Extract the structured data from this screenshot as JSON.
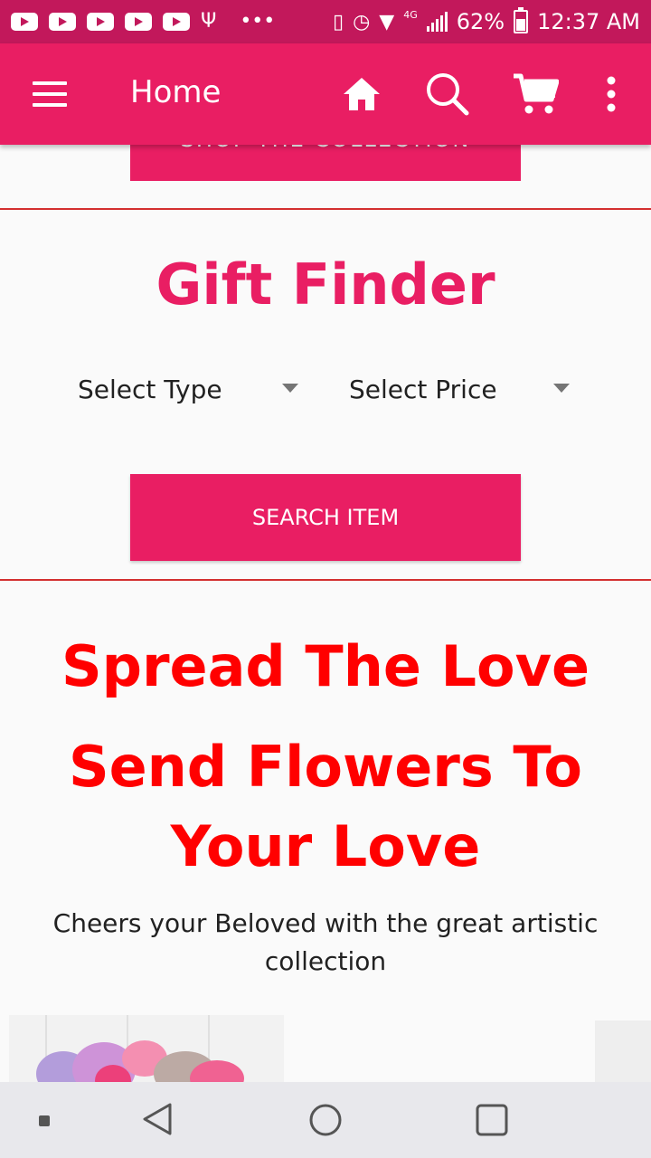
{
  "status_bar": {
    "more": "•••",
    "net_label": "4G",
    "battery": "62%",
    "time": "12:37 AM"
  },
  "app_bar": {
    "title": "Home"
  },
  "hero": {
    "shop_button": "SHOP THE COLLECTION"
  },
  "gift_finder": {
    "title": "Gift Finder",
    "type_select": "Select Type",
    "price_select": "Select Price",
    "search_button": "SEARCH ITEM"
  },
  "promo": {
    "line1": "Spread The Love",
    "line2": "Send Flowers To Your Love",
    "tagline": "Cheers your Beloved with the great artistic collection"
  },
  "colors": {
    "status_bar": "#c2185b",
    "primary": "#e91e63",
    "promo_red": "#ff0000",
    "divider": "#d32f2f"
  },
  "icons": [
    "youtube-icon",
    "usb-icon",
    "vibrate-icon",
    "alarm-icon",
    "wifi-icon",
    "signal-icon",
    "battery-icon",
    "menu-icon",
    "home-icon",
    "search-icon",
    "cart-icon",
    "more-vert-icon",
    "back-icon",
    "home-circle-icon",
    "recents-icon"
  ]
}
